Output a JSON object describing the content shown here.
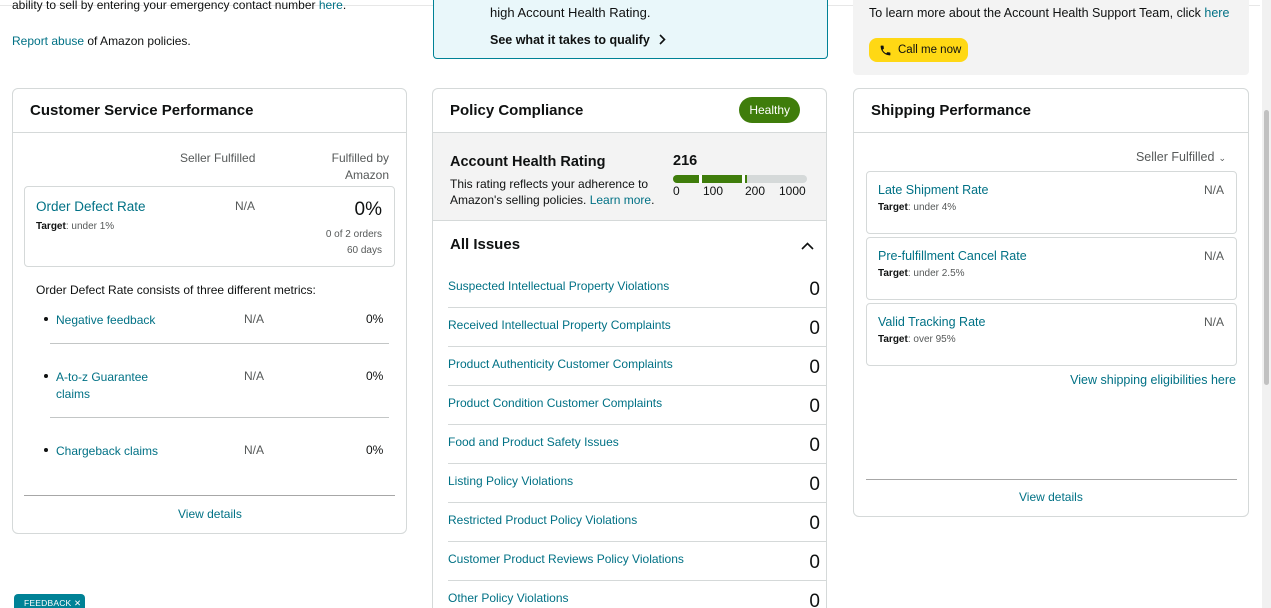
{
  "top": {
    "emergency_text": "ability to sell by entering your emergency contact number ",
    "emergency_link": "here",
    "emergency_period": ".",
    "report_link": "Report abuse",
    "report_text": " of Amazon policies."
  },
  "info_box": {
    "line1": "high Account Health Rating.",
    "qualify": "See what it takes to qualify",
    "chevron_icon": "chevron-right-icon"
  },
  "support": {
    "text": "To learn more about the Account Health Support Team, click ",
    "link": "here",
    "call_button": "Call me now",
    "phone_icon": "phone-icon"
  },
  "customer_service": {
    "title": "Customer Service Performance",
    "col_seller": "Seller Fulfilled",
    "col_amazon_1": "Fulfilled by",
    "col_amazon_2": "Amazon",
    "odr": {
      "title": "Order Defect Rate",
      "target_label": "Target",
      "target_value": ": under 1%",
      "seller_value": "N/A",
      "amazon_value": "0%",
      "orders": "0 of 2 orders",
      "period": "60 days"
    },
    "description": "Order Defect Rate consists of three different metrics:",
    "metrics": [
      {
        "name": "Negative feedback",
        "seller": "N/A",
        "amazon": "0%"
      },
      {
        "name": "A-to-z Guarantee claims",
        "seller": "N/A",
        "amazon": "0%"
      },
      {
        "name": "Chargeback claims",
        "seller": "N/A",
        "amazon": "0%"
      }
    ],
    "view_details": "View details"
  },
  "policy": {
    "title": "Policy Compliance",
    "badge": "Healthy",
    "ahr_title": "Account Health Rating",
    "ahr_text": "This rating reflects your adherence to Amazon's selling policies. ",
    "ahr_link": "Learn more",
    "ahr_period": ".",
    "score": "216",
    "score_value": 216,
    "ticks": [
      "0",
      "100",
      "200",
      "1000"
    ],
    "issues_title": "All Issues",
    "issues": [
      {
        "name": "Suspected Intellectual Property Violations",
        "count": "0"
      },
      {
        "name": "Received Intellectual Property Complaints",
        "count": "0"
      },
      {
        "name": "Product Authenticity Customer Complaints",
        "count": "0"
      },
      {
        "name": "Product Condition Customer Complaints",
        "count": "0"
      },
      {
        "name": "Food and Product Safety Issues",
        "count": "0"
      },
      {
        "name": "Listing Policy Violations",
        "count": "0"
      },
      {
        "name": "Restricted Product Policy Violations",
        "count": "0"
      },
      {
        "name": "Customer Product Reviews Policy Violations",
        "count": "0"
      },
      {
        "name": "Other Policy Violations",
        "count": "0"
      }
    ]
  },
  "shipping": {
    "title": "Shipping Performance",
    "filter": "Seller Fulfilled",
    "metrics": [
      {
        "name": "Late Shipment Rate",
        "target_label": "Target",
        "target_value": ": under 4%",
        "value": "N/A"
      },
      {
        "name": "Pre-fulfillment Cancel Rate",
        "target_label": "Target",
        "target_value": ": under 2.5%",
        "value": "N/A"
      },
      {
        "name": "Valid Tracking Rate",
        "target_label": "Target",
        "target_value": ": over 95%",
        "value": "N/A"
      }
    ],
    "eligibility_link": "View shipping eligibilities here",
    "view_details": "View details"
  },
  "feedback": {
    "label": "FEEDBACK",
    "close": "✕"
  },
  "colors": {
    "link": "#007185",
    "healthy": "#3f7d0b",
    "call_button": "#ffd814",
    "info_border": "#008296"
  }
}
